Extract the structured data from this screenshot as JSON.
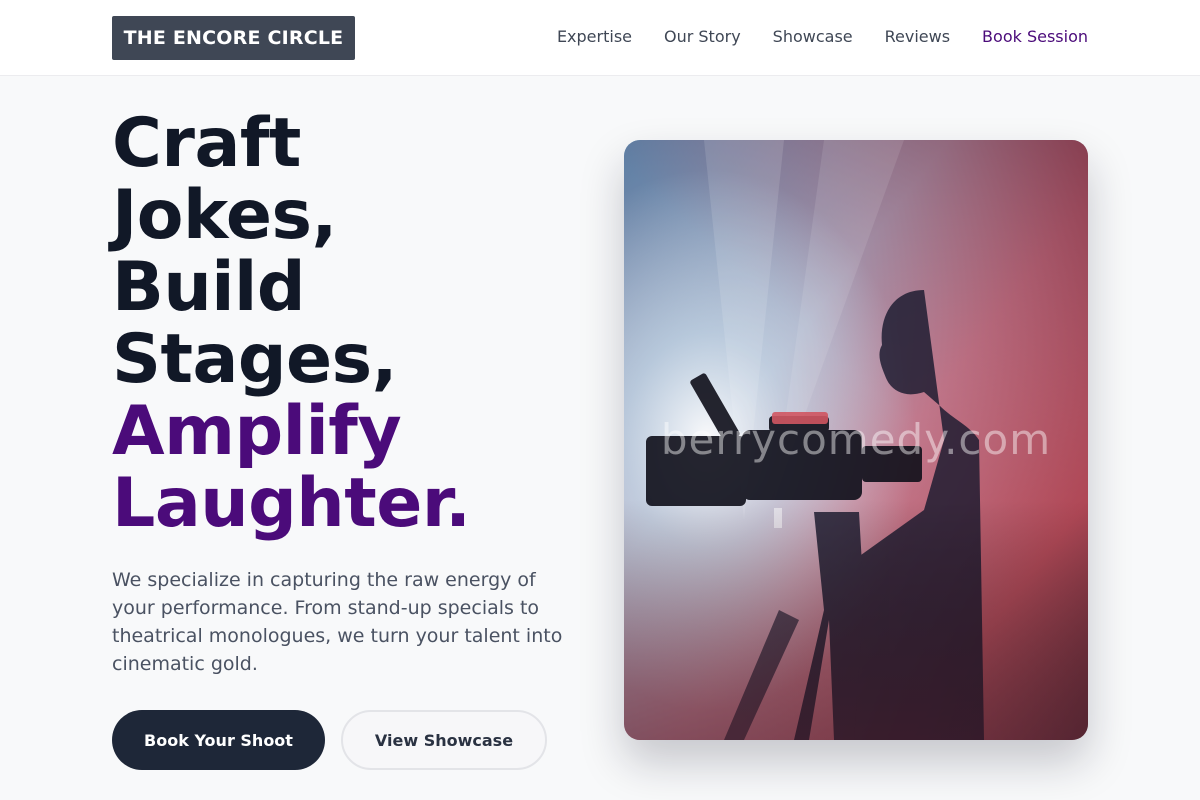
{
  "brand": {
    "logo_text": "THE ENCORE CIRCLE"
  },
  "nav": {
    "links": [
      {
        "label": "Expertise"
      },
      {
        "label": "Our Story"
      },
      {
        "label": "Showcase"
      },
      {
        "label": "Reviews"
      },
      {
        "label": "Book Session"
      }
    ]
  },
  "hero": {
    "headline_lines": [
      "Craft",
      "Jokes,",
      "Build",
      "Stages,"
    ],
    "headline_accent_lines": [
      "Amplify",
      "Laughter."
    ],
    "description": "We specialize in capturing the raw energy of your performance. From stand-up specials to theatrical monologues, we turn your talent into cinematic gold.",
    "primary_button": "Book Your Shoot",
    "secondary_button": "View Showcase",
    "image_watermark": "berrycomedy.com"
  },
  "colors": {
    "accent": "#4b0b7a",
    "dark": "#111827",
    "logo_bg": "#3f4755",
    "button_primary": "#1e2738"
  },
  "icons": {
    "hero_image": "camera-operator-silhouette-photo"
  }
}
